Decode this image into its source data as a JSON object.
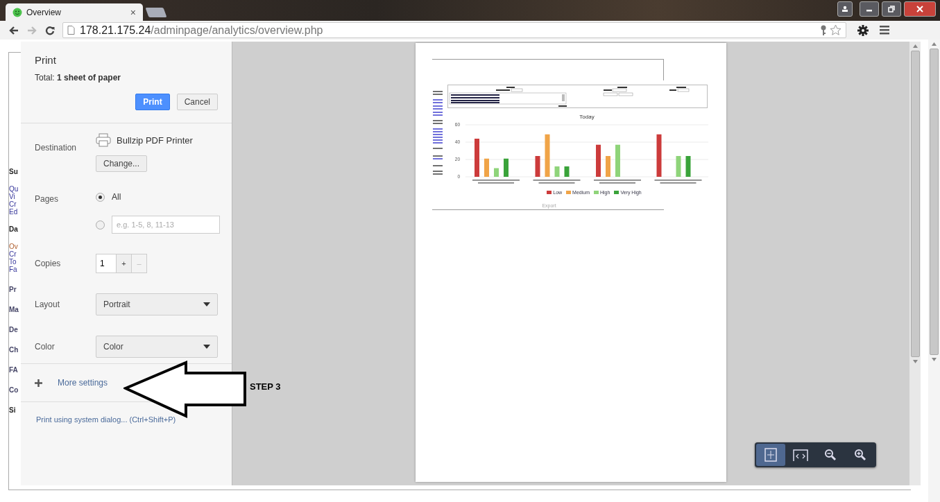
{
  "browser": {
    "tab": {
      "title": "Overview",
      "close": "×"
    },
    "nav": [
      {
        "kind": "back",
        "disabled": false
      },
      {
        "kind": "forward",
        "disabled": true
      },
      {
        "kind": "reload",
        "disabled": false
      }
    ],
    "address": {
      "host": "178.21.175.24",
      "path": "/adminpage/analytics/overview.php"
    }
  },
  "page_behind": {
    "groups": [
      {
        "items": [
          {
            "text": "Su",
            "kind": "heading"
          }
        ]
      },
      {
        "items": [
          {
            "text": "Qu",
            "kind": "link"
          },
          {
            "text": "Vi",
            "kind": "link"
          },
          {
            "text": "Cr",
            "kind": "link"
          },
          {
            "text": "Ed",
            "kind": "link"
          }
        ]
      },
      {
        "items": [
          {
            "text": "Da",
            "kind": "heading"
          }
        ]
      },
      {
        "items": [
          {
            "text": "Ov",
            "kind": "current"
          },
          {
            "text": "Cr",
            "kind": "link"
          },
          {
            "text": "To",
            "kind": "link"
          },
          {
            "text": "Fa",
            "kind": "link"
          }
        ]
      },
      {
        "items": [
          {
            "text": "Pr",
            "kind": "section"
          }
        ]
      },
      {
        "items": [
          {
            "text": "Ma",
            "kind": "section"
          }
        ]
      },
      {
        "items": [
          {
            "text": "De",
            "kind": "section"
          }
        ]
      },
      {
        "items": [
          {
            "text": "Ch",
            "kind": "section"
          }
        ]
      },
      {
        "items": [
          {
            "text": "FA",
            "kind": "section"
          }
        ]
      },
      {
        "items": [
          {
            "text": "Co",
            "kind": "section"
          }
        ]
      },
      {
        "items": [
          {
            "text": "Si",
            "kind": "heading"
          }
        ]
      }
    ]
  },
  "print_dialog": {
    "title": "Print",
    "total": "Total: **1 sheet of paper**",
    "buttons": [
      {
        "label": "Print",
        "kind": "primary"
      },
      {
        "label": "Cancel",
        "kind": "secondary"
      }
    ],
    "destination": {
      "label": "Destination",
      "printer": "Bullzip PDF Printer",
      "change": "Change..."
    },
    "pages": {
      "label": "Pages",
      "options": [
        {
          "kind": "all",
          "label": "All",
          "selected": true
        },
        {
          "kind": "range",
          "placeholder": "e.g. 1-5, 8, 11-13",
          "selected": false
        }
      ]
    },
    "copies": {
      "label": "Copies",
      "value": "1",
      "buttons": [
        {
          "label": "+",
          "disabled": false
        },
        {
          "label": "–",
          "disabled": true
        }
      ]
    },
    "layout": {
      "label": "Layout",
      "value": "Portrait"
    },
    "color": {
      "label": "Color",
      "value": "Color"
    },
    "more_settings": "More settings",
    "system_dialog": "Print using system dialog... (Ctrl+Shift+P)"
  },
  "preview": {
    "chart_data": {
      "type": "bar",
      "title": "Today",
      "legend": "bottom",
      "ylim": [
        0,
        60
      ],
      "yticks": [
        0,
        20,
        40,
        60
      ],
      "series": [
        {
          "name": "Low",
          "color": "#cc3b3b",
          "values": [
            44,
            24,
            37,
            49
          ]
        },
        {
          "name": "Medium",
          "color": "#f0a448",
          "values": [
            21,
            49,
            24,
            null
          ]
        },
        {
          "name": "High",
          "color": "#8fd47a",
          "values": [
            10,
            12,
            37,
            24
          ]
        },
        {
          "name": "Very High",
          "color": "#3aa33a",
          "values": [
            21,
            12,
            null,
            24
          ]
        }
      ]
    },
    "export": "Export",
    "controls": [
      {
        "kind": "fit",
        "selected": true
      },
      {
        "kind": "width",
        "selected": false
      },
      {
        "kind": "zoom-out",
        "selected": false
      },
      {
        "kind": "zoom-in",
        "selected": false
      }
    ]
  },
  "annotation": {
    "label": "STEP 3"
  }
}
